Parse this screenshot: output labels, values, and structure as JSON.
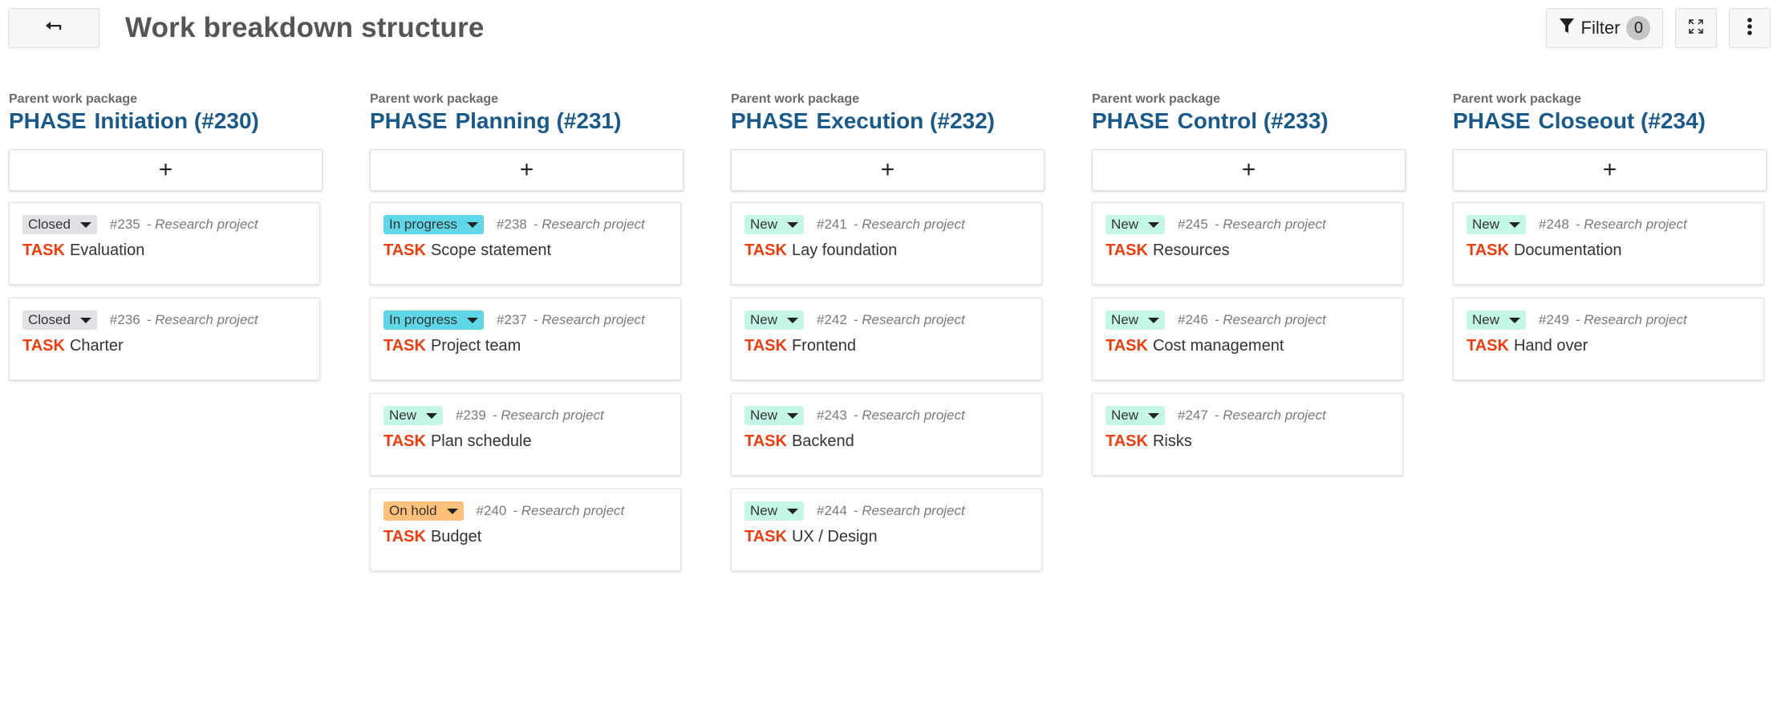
{
  "header": {
    "back_icon": "arrow-left-icon",
    "title": "Work breakdown structure",
    "filter_label": "Filter",
    "filter_count": "0",
    "filter_icon": "filter-icon",
    "fullscreen_icon": "fullscreen-icon",
    "more_icon": "more-vertical-icon"
  },
  "colors": {
    "status_closed": "#dfe1e5",
    "status_in_progress": "#5fd7e7",
    "status_new": "#c5f7e7",
    "status_on_hold": "#fec07b",
    "type_task": "#f03c0c",
    "phase_title": "#1a5a8a"
  },
  "add_label": "+",
  "columns": [
    {
      "label": "Parent work package",
      "type": "PHASE",
      "title": "Initiation (#230)",
      "cards": [
        {
          "status": "Closed",
          "status_key": "status_closed",
          "id": "#235",
          "project": "- Research project",
          "type": "TASK",
          "subject": "Evaluation"
        },
        {
          "status": "Closed",
          "status_key": "status_closed",
          "id": "#236",
          "project": "- Research project",
          "type": "TASK",
          "subject": "Charter"
        }
      ]
    },
    {
      "label": "Parent work package",
      "type": "PHASE",
      "title": "Planning (#231)",
      "cards": [
        {
          "status": "In progress",
          "status_key": "status_in_progress",
          "id": "#238",
          "project": "- Research project",
          "type": "TASK",
          "subject": "Scope statement"
        },
        {
          "status": "In progress",
          "status_key": "status_in_progress",
          "id": "#237",
          "project": "- Research project",
          "type": "TASK",
          "subject": "Project team"
        },
        {
          "status": "New",
          "status_key": "status_new",
          "id": "#239",
          "project": "- Research project",
          "type": "TASK",
          "subject": "Plan schedule"
        },
        {
          "status": "On hold",
          "status_key": "status_on_hold",
          "id": "#240",
          "project": "- Research project",
          "type": "TASK",
          "subject": "Budget"
        }
      ]
    },
    {
      "label": "Parent work package",
      "type": "PHASE",
      "title": "Execution (#232)",
      "cards": [
        {
          "status": "New",
          "status_key": "status_new",
          "id": "#241",
          "project": "- Research project",
          "type": "TASK",
          "subject": "Lay foundation"
        },
        {
          "status": "New",
          "status_key": "status_new",
          "id": "#242",
          "project": "- Research project",
          "type": "TASK",
          "subject": "Frontend"
        },
        {
          "status": "New",
          "status_key": "status_new",
          "id": "#243",
          "project": "- Research project",
          "type": "TASK",
          "subject": "Backend"
        },
        {
          "status": "New",
          "status_key": "status_new",
          "id": "#244",
          "project": "- Research project",
          "type": "TASK",
          "subject": "UX / Design"
        }
      ]
    },
    {
      "label": "Parent work package",
      "type": "PHASE",
      "title": "Control (#233)",
      "cards": [
        {
          "status": "New",
          "status_key": "status_new",
          "id": "#245",
          "project": "- Research project",
          "type": "TASK",
          "subject": "Resources"
        },
        {
          "status": "New",
          "status_key": "status_new",
          "id": "#246",
          "project": "- Research project",
          "type": "TASK",
          "subject": "Cost management"
        },
        {
          "status": "New",
          "status_key": "status_new",
          "id": "#247",
          "project": "- Research project",
          "type": "TASK",
          "subject": "Risks"
        }
      ]
    },
    {
      "label": "Parent work package",
      "type": "PHASE",
      "title": "Closeout (#234)",
      "cards": [
        {
          "status": "New",
          "status_key": "status_new",
          "id": "#248",
          "project": "- Research project",
          "type": "TASK",
          "subject": "Documentation"
        },
        {
          "status": "New",
          "status_key": "status_new",
          "id": "#249",
          "project": "- Research project",
          "type": "TASK",
          "subject": "Hand over"
        }
      ]
    }
  ]
}
